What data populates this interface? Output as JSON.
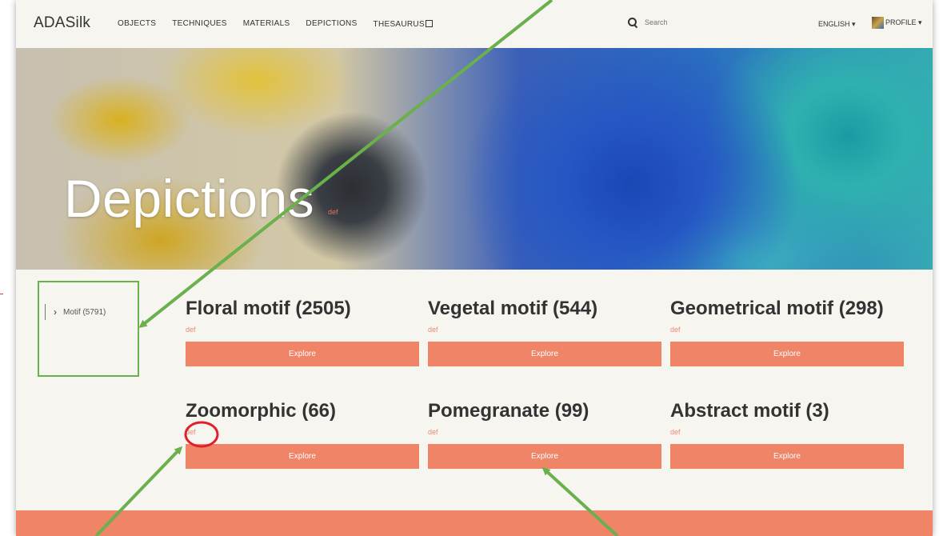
{
  "navbar": {
    "brand": "ADASilk",
    "links": [
      "OBJECTS",
      "TECHNIQUES",
      "MATERIALS",
      "DEPICTIONS",
      "THESAURUS"
    ],
    "search_placeholder": "Search",
    "language": "ENGLISH ▾",
    "profile": "PROFILE ▾"
  },
  "hero": {
    "title": "Depictions",
    "mark": "def"
  },
  "sidebar": {
    "items": [
      {
        "chevron": "›",
        "label": "Motif (5791)"
      }
    ]
  },
  "cards": [
    {
      "title": "Floral motif (2505)",
      "def": "def",
      "button": "Explore"
    },
    {
      "title": "Vegetal motif (544)",
      "def": "def",
      "button": "Explore"
    },
    {
      "title": "Geometrical motif (298)",
      "def": "def",
      "button": "Explore"
    },
    {
      "title": "Zoomorphic (66)",
      "def": "def",
      "button": "Explore"
    },
    {
      "title": "Pomegranate (99)",
      "def": "def",
      "button": "Explore"
    },
    {
      "title": "Abstract motif (3)",
      "def": "def",
      "button": "Explore"
    }
  ],
  "colors": {
    "accent": "#ef8466",
    "annotation_green": "#6ab04c",
    "annotation_red": "#e0202a"
  }
}
